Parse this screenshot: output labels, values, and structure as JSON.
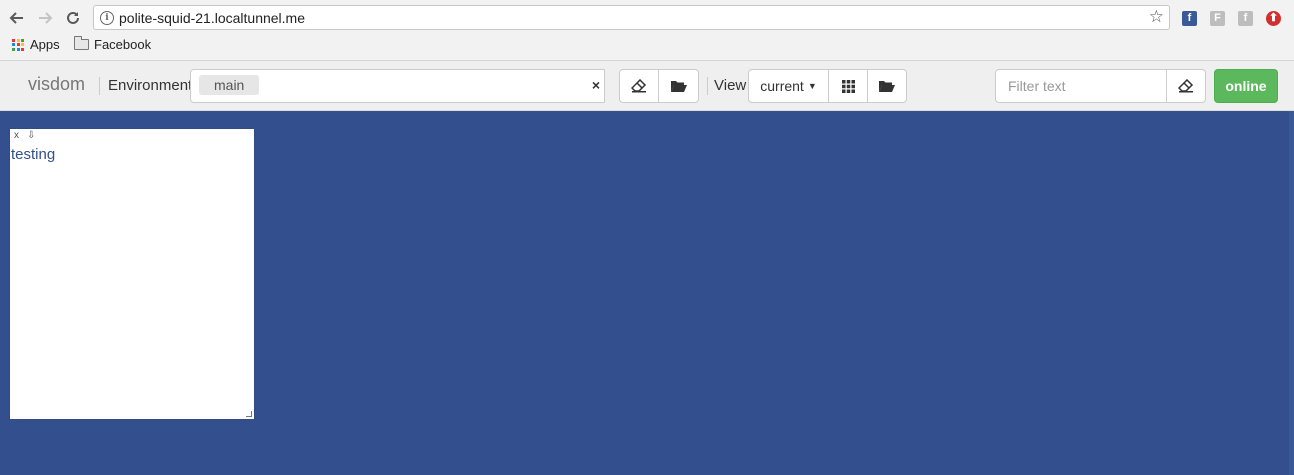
{
  "browser": {
    "url": "polite-squid-21.localtunnel.me",
    "bookmarks": [
      {
        "label": "Apps",
        "icon": "apps-grid-icon"
      },
      {
        "label": "Facebook",
        "icon": "folder-icon"
      }
    ],
    "extensions": [
      {
        "name": "facebook-extension-icon",
        "glyph": "f",
        "color": "#3b5998"
      },
      {
        "name": "f-extension-icon-1",
        "glyph": "F",
        "color": "#bdbdbd"
      },
      {
        "name": "f-extension-icon-2",
        "glyph": "f",
        "color": "#bdbdbd"
      },
      {
        "name": "upload-extension-icon",
        "glyph": "⬆",
        "color": "#d32f2f"
      }
    ]
  },
  "toolbar": {
    "brand": "visdom",
    "environment_label": "Environment",
    "environment_tag": "main",
    "environment_clear": "×",
    "view_label": "View",
    "view_select": "current",
    "filter_placeholder": "Filter text",
    "status_label": "online",
    "status_color": "#5cb85c"
  },
  "main": {
    "background": "#334f8d",
    "panes": [
      {
        "close_glyph": "x",
        "download_glyph": "⇩",
        "text": "testing"
      }
    ]
  }
}
